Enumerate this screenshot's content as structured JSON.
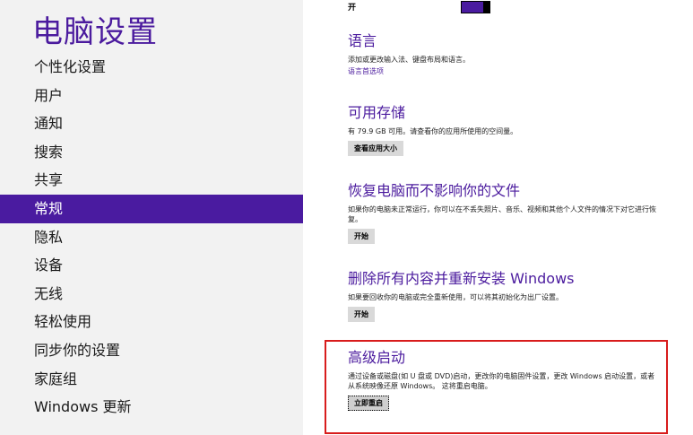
{
  "app_title": "电脑设置",
  "nav": {
    "items": [
      {
        "label": "个性化设置"
      },
      {
        "label": "用户"
      },
      {
        "label": "通知"
      },
      {
        "label": "搜索"
      },
      {
        "label": "共享"
      },
      {
        "label": "常规",
        "selected": true
      },
      {
        "label": "隐私"
      },
      {
        "label": "设备"
      },
      {
        "label": "无线"
      },
      {
        "label": "轻松使用"
      },
      {
        "label": "同步你的设置"
      },
      {
        "label": "家庭组"
      },
      {
        "label": "Windows 更新"
      }
    ]
  },
  "toggle": {
    "label": "开",
    "state": "on",
    "color": "#4a1ba0"
  },
  "sections": {
    "language": {
      "title": "语言",
      "desc": "添加或更改输入法、键盘布局和语言。",
      "link": "语言首选项"
    },
    "storage": {
      "title": "可用存储",
      "desc": "有 79.9 GB 可用。请查看你的应用所使用的空间量。",
      "button": "查看应用大小"
    },
    "refresh": {
      "title": "恢复电脑而不影响你的文件",
      "desc": "如果你的电脑未正常运行，你可以在不丢失照片、音乐、视频和其他个人文件的情况下对它进行恢复。",
      "button": "开始"
    },
    "reset": {
      "title": "删除所有内容并重新安装 Windows",
      "desc": "如果要回收你的电脑或完全重新使用，可以将其初始化为出厂设置。",
      "button": "开始"
    },
    "advanced": {
      "title": "高级启动",
      "desc": "通过设备或磁盘(如 U 盘或 DVD)启动，更改你的电脑固件设置，更改 Windows 启动设置，或者从系统映像还原 Windows。 这将重启电脑。",
      "button": "立即重启"
    }
  },
  "colors": {
    "accent": "#4a1ba0",
    "highlight": "#d81c1c",
    "sidebar_bg": "#f2f2f2"
  }
}
